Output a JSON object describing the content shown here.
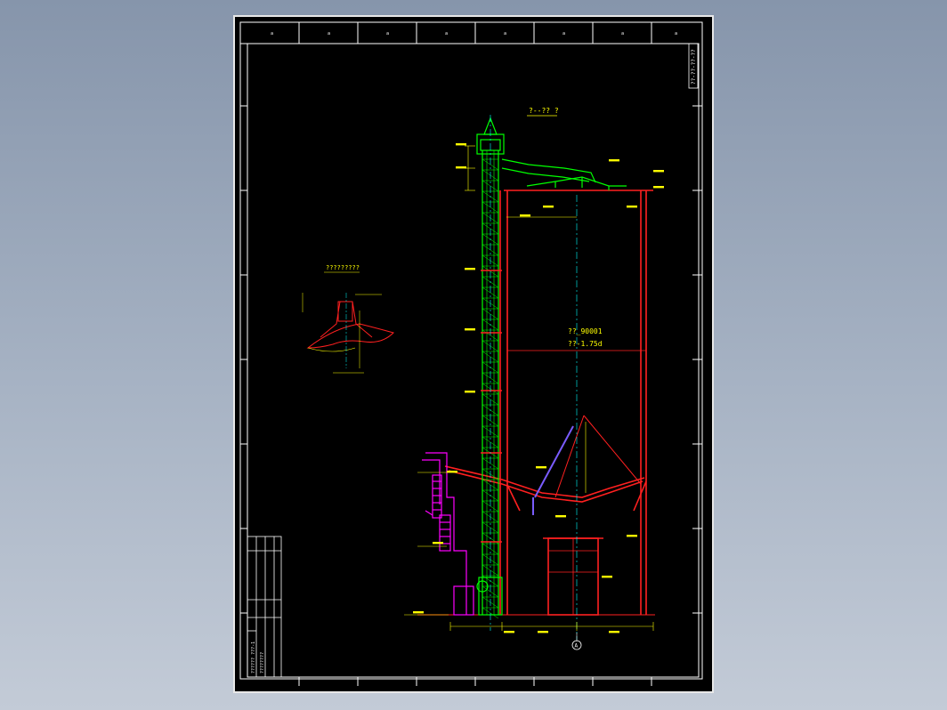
{
  "colors": {
    "sheet": "#000000",
    "frame": "#ffffff",
    "structure": "#ff2020",
    "elevator": "#00ff00",
    "platform": "#ff00ff",
    "dimension": "#ffff00",
    "centerline": "#00ffff",
    "chute": "#7a5cff"
  },
  "drawing": {
    "section_title": "?--?? ?",
    "detail_title": "?????????",
    "drawing_code": "??-??-??-??",
    "silo_label_1": "??_90001",
    "silo_label_2": "??-1.75d",
    "axis_bubble": "A",
    "border_letters": [
      "a",
      "a",
      "a",
      "a",
      "a",
      "a",
      "a",
      "a"
    ],
    "title_block_name": "?????? ???-1",
    "title_block_sub": "????????"
  }
}
